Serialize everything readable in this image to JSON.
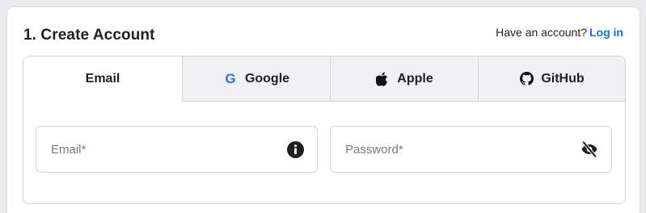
{
  "header": {
    "title": "1. Create Account",
    "have_account_text": "Have an account?",
    "login_link": "Log in"
  },
  "tabs": [
    {
      "label": "Email",
      "icon": "",
      "active": true
    },
    {
      "label": "Google",
      "icon": "google-icon",
      "active": false
    },
    {
      "label": "Apple",
      "icon": "apple-icon",
      "active": false
    },
    {
      "label": "GitHub",
      "icon": "github-icon",
      "active": false
    }
  ],
  "form": {
    "email": {
      "placeholder": "Email*",
      "value": "",
      "trailing_icon": "info-icon"
    },
    "password": {
      "placeholder": "Password*",
      "value": "",
      "trailing_icon": "eye-slash-icon"
    }
  },
  "colors": {
    "link": "#1a6ed8",
    "google_blue": "#2a6ee0",
    "text": "#1f1f22",
    "inactive_tab_bg": "#f1f1f4",
    "border": "#d3d3d8"
  }
}
